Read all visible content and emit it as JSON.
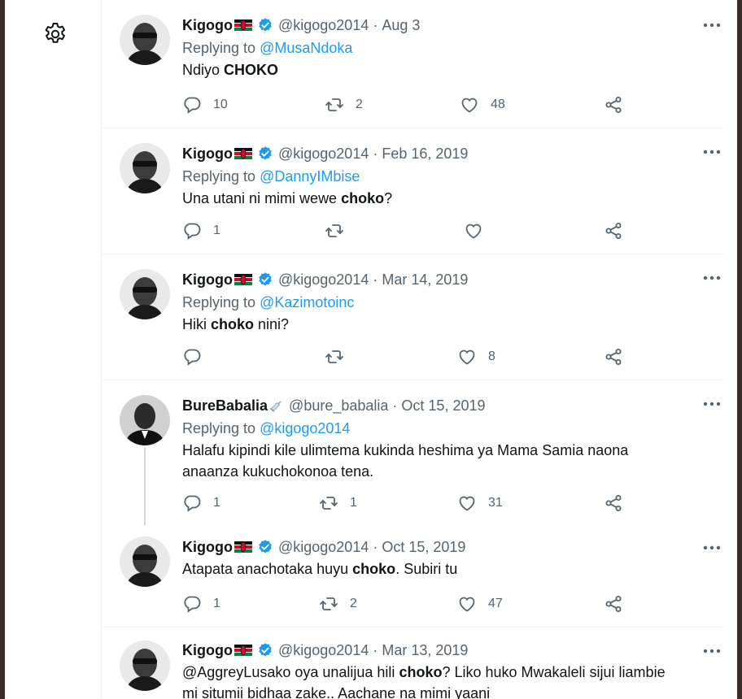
{
  "tweets": [
    {
      "name": "Kigogo",
      "handle": "@kigogo2014",
      "sep": "·",
      "date": "Aug 3",
      "reply_prefix": "Replying to",
      "reply_to": "@MusaNdoka",
      "text_before": "Ndiyo ",
      "text_bold": "CHOKO",
      "text_after": "",
      "replies": "10",
      "retweets": "2",
      "likes": "48"
    },
    {
      "name": "Kigogo",
      "handle": "@kigogo2014",
      "sep": "·",
      "date": "Feb 16, 2019",
      "reply_prefix": "Replying to",
      "reply_to": "@DannyIMbise",
      "text_before": "Una utani ni mimi wewe ",
      "text_bold": "choko",
      "text_after": "?",
      "replies": "1",
      "retweets": "",
      "likes": ""
    },
    {
      "name": "Kigogo",
      "handle": "@kigogo2014",
      "sep": "·",
      "date": "Mar 14, 2019",
      "reply_prefix": "Replying to",
      "reply_to": "@Kazimotoinc",
      "text_before": "Hiki ",
      "text_bold": "choko",
      "text_after": " nini?",
      "replies": "",
      "retweets": "",
      "likes": "8"
    },
    {
      "name": "BureBabalia",
      "handle": "@bure_babalia",
      "sep": "·",
      "date": "Oct 15, 2019",
      "reply_prefix": "Replying to",
      "reply_to": "@kigogo2014",
      "text_line1": "Halafu kipindi kile ulimtema kukinda heshima ya Mama Samia  naona",
      "text_line2": "anaanza kukuchokonoa tena.",
      "replies": "1",
      "retweets": "1",
      "likes": "31"
    },
    {
      "name": "Kigogo",
      "handle": "@kigogo2014",
      "sep": "·",
      "date": "Oct 15, 2019",
      "text_before": "Atapata anachotaka huyu ",
      "text_bold": "choko",
      "text_after": ". Subiri tu",
      "replies": "1",
      "retweets": "2",
      "likes": "47"
    },
    {
      "name": "Kigogo",
      "handle": "@kigogo2014",
      "sep": "·",
      "date": "Mar 13, 2019",
      "text_before": "@AggreyLusako oya unalijua hili ",
      "text_bold": "choko",
      "text_after": "? Liko huko Mwakaleli sijui liambie",
      "text_line2": "mi situmii bidhaa zake.. Aachane na mimi yaani"
    }
  ],
  "icons": {
    "settings": "gear-icon",
    "reply": "reply-icon",
    "retweet": "retweet-icon",
    "like": "heart-icon",
    "share": "share-icon",
    "more": "more-icon",
    "verified": "verified-badge-icon",
    "flag": "kenya-flag-icon"
  },
  "colors": {
    "link": "#1d9bf0",
    "secondary_text": "#536471",
    "verified": "#1d9bf0",
    "border": "#eff3f4"
  }
}
